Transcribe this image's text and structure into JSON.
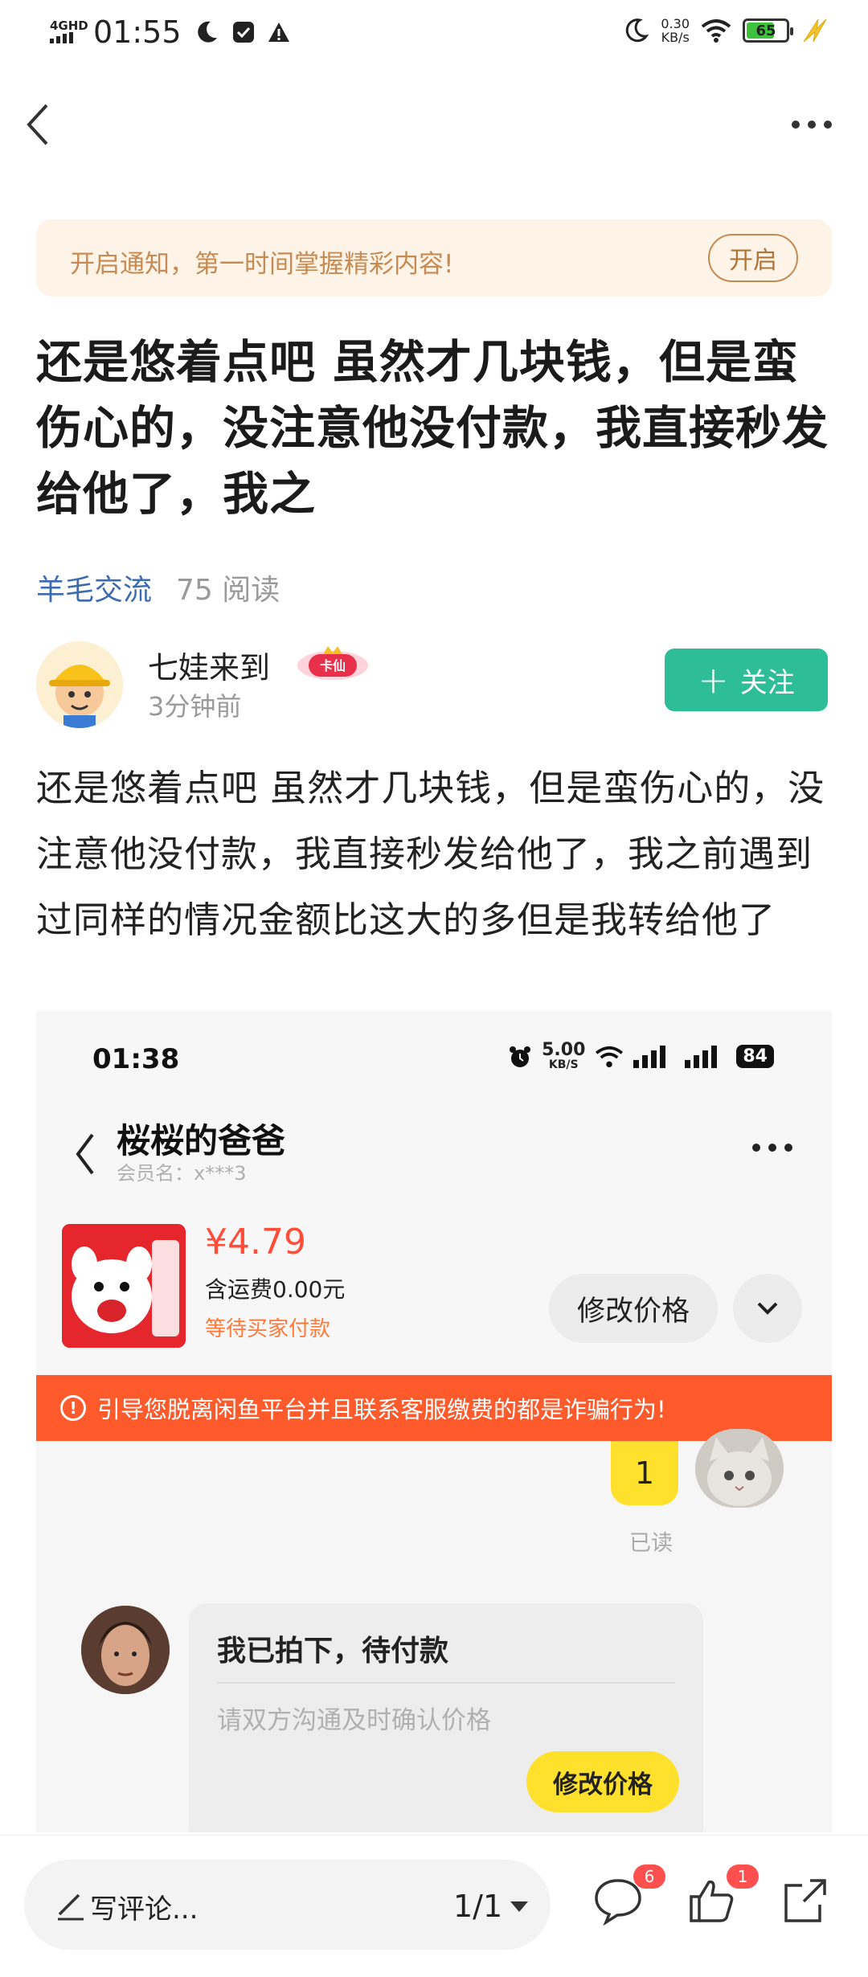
{
  "status_bar": {
    "network": "4GHD",
    "time": "01:55",
    "speed_value": "0.30",
    "speed_unit": "KB/s",
    "battery": "65"
  },
  "notice": {
    "text": "开启通知，第一时间掌握精彩内容!",
    "button": "开启"
  },
  "post": {
    "title": "还是悠着点吧 虽然才几块钱，但是蛮伤心的，没注意他没付款，我直接秒发给他了，我之",
    "category": "羊毛交流",
    "reads": "75 阅读",
    "author": "七娃来到",
    "badge": "卡仙",
    "time": "3分钟前",
    "follow_label": "关注",
    "body": "还是悠着点吧 虽然才几块钱，但是蛮伤心的，没注意他没付款，我直接秒发给他了，我之前遇到过同样的情况金额比这大的多但是我转给他了"
  },
  "screenshot": {
    "time": "01:38",
    "speed_value": "5.00",
    "speed_unit": "KB/S",
    "battery": "84",
    "chat_name": "桜桜的爸爸",
    "member": "会员名：x***3",
    "price": "¥4.79",
    "shipping": "含运费0.00元",
    "status": "等待买家付款",
    "edit_price": "修改价格",
    "warning": "引导您脱离闲鱼平台并且联系客服缴费的都是诈骗行为!",
    "message_1": "1",
    "read": "已读",
    "card_title": "我已拍下，待付款",
    "card_sub": "请双方沟通及时确认价格",
    "card_button": "修改价格"
  },
  "bottom_bar": {
    "comment_placeholder": "写评论...",
    "pager": "1/1",
    "comment_count": "6",
    "like_count": "1"
  },
  "colors": {
    "accent_green": "#2dbd97",
    "category_blue": "#3d6bb0",
    "warning_orange": "#ff5a2c",
    "yellow": "#ffe02d"
  }
}
